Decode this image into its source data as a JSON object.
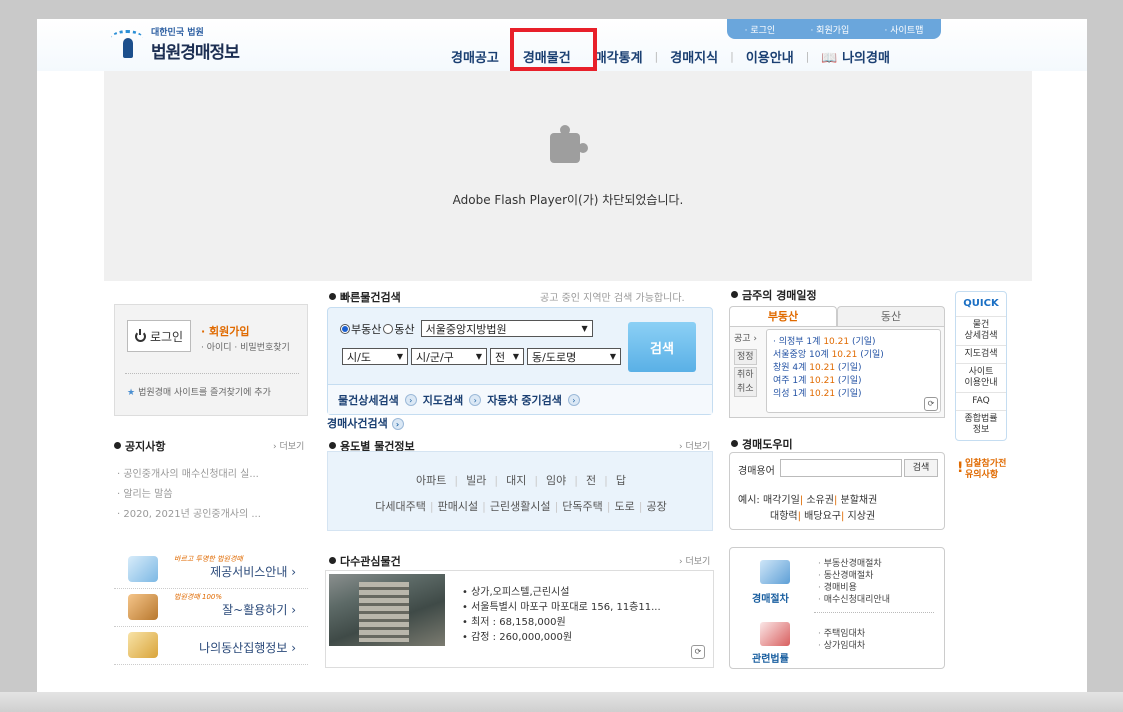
{
  "header": {
    "logo_small": "대한민국 법원",
    "logo_big": "법원경매정보",
    "top_links": [
      "· 로그인",
      "· 회원가입",
      "· 사이트맵"
    ],
    "nav": [
      "경매공고",
      "경매물건",
      "매각통계",
      "경매지식",
      "이용안내",
      "나의경매"
    ],
    "highlighted_nav": "경매물건",
    "highlight_color": "#e8202a"
  },
  "flash": {
    "message": "Adobe Flash Player이(가) 차단되었습니다."
  },
  "login": {
    "button": "로그인",
    "join": "회원가입",
    "find_id": "아이디 · 비밀번호찾기",
    "favorite": "법원경매 사이트를 즐겨찾기에 추가"
  },
  "notice": {
    "title": "공지사항",
    "more": "› 더보기",
    "items": [
      "공인중개사의 매수신청대리 실...",
      "알리는 말씀",
      "2020, 2021년 공인중개사의 ..."
    ]
  },
  "promo": {
    "items": [
      {
        "script": "바르고 투명한 법원경매",
        "label": "제공서비스안내 ›"
      },
      {
        "script": "법원경매 100%",
        "label": "잘~활용하기 ›"
      },
      {
        "script": "",
        "label": "나의동산집행정보 ›"
      }
    ]
  },
  "quick_search": {
    "title": "빠른물건검색",
    "note": "공고 중인 지역만 검색 가능합니다.",
    "radio_real": "부동산",
    "radio_movable": "동산",
    "court": "서울중앙지방법원",
    "sido": "시/도",
    "sigungu": "시/군/구",
    "jeon": "전",
    "dong": "동/도로명",
    "search_button": "검색",
    "links": [
      "물건상세검색",
      "지도검색",
      "자동차 중기검색"
    ],
    "extra_link": "경매사건검색"
  },
  "usage": {
    "title": "용도별 물건정보",
    "more": "› 더보기",
    "row1": [
      "아파트",
      "빌라",
      "대지",
      "임야",
      "전",
      "답"
    ],
    "row2": [
      "다세대주택",
      "판매시설",
      "근린생활시설",
      "단독주택",
      "도로",
      "공장"
    ]
  },
  "popular": {
    "title": "다수관심물건",
    "more": "› 더보기",
    "lines": [
      "상가,오피스텔,근린시설",
      "서울특별시 마포구 마포대로 156, 11층11...",
      "최저 : 68,158,000원",
      "감정 : 260,000,000원"
    ]
  },
  "schedule": {
    "title": "금주의 경매일정",
    "tab_real": "부동산",
    "tab_movable": "동산",
    "side": [
      "공고 ›",
      "정정",
      "취하",
      "취소"
    ],
    "items": [
      {
        "name": "의정부 1계 ",
        "date": "10.21",
        "rest": " (기일)"
      },
      {
        "name": "서울중앙 10계 ",
        "date": "10.21",
        "rest": " (기일)"
      },
      {
        "name": "창원 4계 ",
        "date": "10.21",
        "rest": " (기일)"
      },
      {
        "name": "여주 1계 ",
        "date": "10.21",
        "rest": " (기일)"
      },
      {
        "name": "의성 1계 ",
        "date": "10.21",
        "rest": " (기일)"
      }
    ]
  },
  "helper": {
    "title": "경매도우미",
    "term_label": "경매용어",
    "term_button": "검색",
    "example_label": "예시:",
    "examples1": [
      "매각기일",
      "소유권",
      "분할채권"
    ],
    "examples2": [
      "대항력",
      "배당요구",
      "지상권"
    ]
  },
  "procedure": {
    "cap1": "경매절차",
    "list1": [
      "부동산경매절차",
      "동산경매절차",
      "경매비용",
      "매수신청대리안내"
    ],
    "cap2": "관련법률",
    "list2": [
      "주택임대차",
      "상가임대차"
    ]
  },
  "quick": {
    "title": "QUICK",
    "items": [
      "물건\n상세검색",
      "지도검색",
      "사이트\n이용안내",
      "FAQ",
      "종합법률\n정보"
    ],
    "warning": "입찰참가전\n유의사항"
  }
}
